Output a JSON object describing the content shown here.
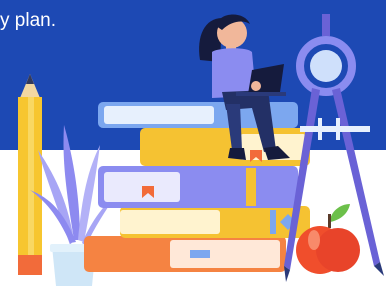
{
  "hero": {
    "text_fragment": "y plan.",
    "illustration": "study-books-illustration"
  },
  "colors": {
    "banner": "#1d49b4",
    "pencil": "#f7c62f",
    "book_orange": "#f58342",
    "book_purple": "#8b8cf0",
    "book_yellow": "#f5c232",
    "book_blue": "#7ca7ef",
    "compass": "#6a62d6",
    "apple": "#f04e2c",
    "plant": "#a7a5f5"
  }
}
